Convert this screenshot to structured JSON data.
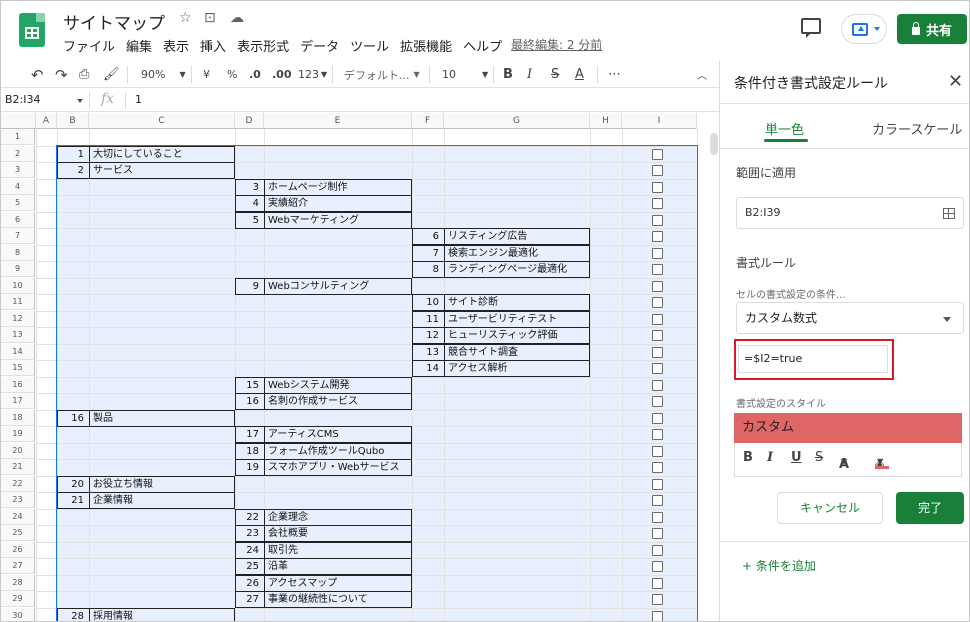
{
  "app": {
    "doc_title": "サイトマップ",
    "last_edit": "最終編集: 2 分前",
    "share_label": "共有",
    "menu": [
      "ファイル",
      "編集",
      "表示",
      "挿入",
      "表示形式",
      "データ",
      "ツール",
      "拡張機能",
      "ヘルプ"
    ]
  },
  "toolbar": {
    "zoom": "90%",
    "currency": "¥",
    "percent": "%",
    "dec_less": ".0",
    "dec_more": ".00",
    "numfmt": "123",
    "font": "デフォルト...",
    "font_size": "10",
    "bold": "B",
    "italic": "I",
    "strike": "S",
    "text_color": "A",
    "more": "⋯"
  },
  "formula_bar": {
    "namebox": "B2:I34",
    "fx": "fx",
    "value": "1"
  },
  "columns": [
    "A",
    "B",
    "C",
    "D",
    "E",
    "F",
    "G",
    "H",
    "I"
  ],
  "rows": [
    "1",
    "2",
    "3",
    "4",
    "5",
    "6",
    "7",
    "8",
    "9",
    "10",
    "11",
    "12",
    "13",
    "14",
    "15",
    "16",
    "17",
    "18",
    "19",
    "20",
    "21",
    "22",
    "23",
    "24",
    "25",
    "26",
    "27",
    "28",
    "29",
    "30"
  ],
  "sitemap": [
    {
      "n": "1",
      "label": "大切にしていること",
      "level": 0
    },
    {
      "n": "2",
      "label": "サービス",
      "level": 0
    },
    {
      "n": "3",
      "label": "ホームページ制作",
      "level": 1
    },
    {
      "n": "4",
      "label": "実績紹介",
      "level": 1
    },
    {
      "n": "5",
      "label": "Webマーケティング",
      "level": 1
    },
    {
      "n": "6",
      "label": "リスティング広告",
      "level": 2
    },
    {
      "n": "7",
      "label": "検索エンジン最適化",
      "level": 2
    },
    {
      "n": "8",
      "label": "ランディングページ最適化",
      "level": 2
    },
    {
      "n": "9",
      "label": "Webコンサルティング",
      "level": 1
    },
    {
      "n": "10",
      "label": "サイト診断",
      "level": 2
    },
    {
      "n": "11",
      "label": "ユーザービリティテスト",
      "level": 2
    },
    {
      "n": "12",
      "label": "ヒューリスティック評価",
      "level": 2
    },
    {
      "n": "13",
      "label": "競合サイト調査",
      "level": 2
    },
    {
      "n": "14",
      "label": "アクセス解析",
      "level": 2
    },
    {
      "n": "15",
      "label": "Webシステム開発",
      "level": 1
    },
    {
      "n": "16",
      "label": "名刺の作成サービス",
      "level": 1
    },
    {
      "n": "16",
      "label": "製品",
      "level": 0
    },
    {
      "n": "17",
      "label": "アーティスCMS",
      "level": 1
    },
    {
      "n": "18",
      "label": "フォーム作成ツールQubo",
      "level": 1
    },
    {
      "n": "19",
      "label": "スマホアプリ・Webサービス",
      "level": 1
    },
    {
      "n": "20",
      "label": "お役立ち情報",
      "level": 0
    },
    {
      "n": "21",
      "label": "企業情報",
      "level": 0
    },
    {
      "n": "22",
      "label": "企業理念",
      "level": 1
    },
    {
      "n": "23",
      "label": "会社概要",
      "level": 1
    },
    {
      "n": "24",
      "label": "取引先",
      "level": 1
    },
    {
      "n": "25",
      "label": "沿革",
      "level": 1
    },
    {
      "n": "26",
      "label": "アクセスマップ",
      "level": 1
    },
    {
      "n": "27",
      "label": "事業の継続性について",
      "level": 1
    },
    {
      "n": "28",
      "label": "採用情報",
      "level": 0
    }
  ],
  "panel": {
    "title": "条件付き書式設定ルール",
    "close": "✕",
    "tab_single": "単一色",
    "tab_scale": "カラースケール",
    "range_label": "範囲に適用",
    "range_value": "B2:I39",
    "rules_label": "書式ルール",
    "condition_label": "セルの書式設定の条件...",
    "condition_value": "カスタム数式",
    "formula": "=$I2=true",
    "style_label": "書式設定のスタイル",
    "style_preview": "カスタム",
    "fmt_bold": "B",
    "fmt_italic": "I",
    "fmt_underline": "U",
    "fmt_strike": "S",
    "fmt_text": "A",
    "cancel": "キャンセル",
    "done": "完了",
    "add_rule": "+ 条件を追加",
    "preview_color": "#e06666",
    "accent_color": "#188038"
  }
}
